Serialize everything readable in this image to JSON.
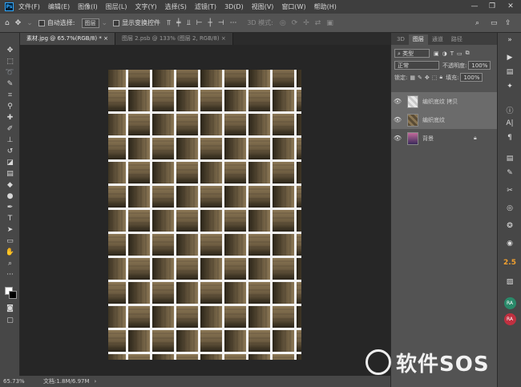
{
  "app": {
    "logo": "Ps"
  },
  "menubar": {
    "items": [
      "文件(F)",
      "编辑(E)",
      "图像(I)",
      "图层(L)",
      "文字(Y)",
      "选择(S)",
      "滤镜(T)",
      "3D(D)",
      "视图(V)",
      "窗口(W)",
      "帮助(H)"
    ]
  },
  "window_controls": {
    "minimize": "—",
    "maximize": "❐",
    "close": "✕"
  },
  "options_bar": {
    "auto_select_label": "自动选择:",
    "auto_select_value": "图层",
    "show_transform_label": "显示变换控件",
    "mode_3d_label": "3D 模式:"
  },
  "tabs": [
    {
      "label": "素材.jpg @ 65.7%(RGB/8) *",
      "close": "×"
    },
    {
      "label": "图层 2.psb @ 133% (图层 2, RGB/8)",
      "close": "×"
    }
  ],
  "status": {
    "zoom": "65.73%",
    "doc_info": "文档:1.8M/6.97M"
  },
  "panel": {
    "tabs": [
      "3D",
      "图层",
      "通道",
      "路径"
    ],
    "filter_kind": "类型",
    "blend_mode": "正常",
    "opacity_label": "不透明度:",
    "opacity_value": "100%",
    "lock_label": "锁定:",
    "fill_label": "填充:",
    "fill_value": "100%",
    "layers": [
      {
        "name": "编织底纹 拷贝",
        "selected": true
      },
      {
        "name": "编织底纹",
        "selected": true
      },
      {
        "name": "背景",
        "selected": false,
        "locked": true
      }
    ]
  },
  "right_toolbar": {
    "badge": "2.5",
    "ra1": "RA",
    "ra2": "RA"
  },
  "watermark": {
    "text": "软件SOS"
  },
  "colors": {
    "accent": "#31a8ff",
    "weave_dark": "#2a2418",
    "weave_light": "#8a7654",
    "bg": "#262626"
  }
}
